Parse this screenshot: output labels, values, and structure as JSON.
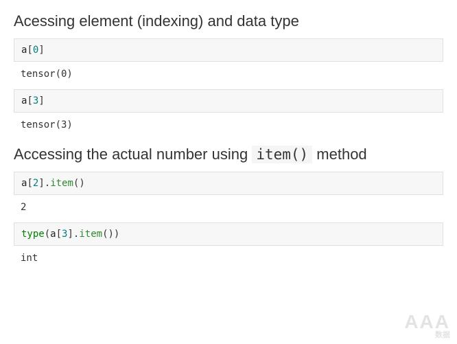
{
  "heading1": "Acessing element (indexing) and data type",
  "cell1": {
    "var": "a",
    "open": "[",
    "idx": "0",
    "close": "]"
  },
  "out1": "tensor(0)",
  "cell2": {
    "var": "a",
    "open": "[",
    "idx": "3",
    "close": "]"
  },
  "out2": "tensor(3)",
  "heading2_pre": "Accessing the actual number using ",
  "heading2_code": "item()",
  "heading2_post": " method",
  "cell3": {
    "var": "a",
    "open": "[",
    "idx": "2",
    "close": "]",
    "dot": ".",
    "method": "item",
    "parens": "()"
  },
  "out3": "2",
  "cell4": {
    "builtin": "type",
    "popen": "(",
    "var": "a",
    "open": "[",
    "idx": "3",
    "close": "]",
    "dot": ".",
    "method": "item",
    "mparens": "()",
    "pclose": ")"
  },
  "out4": "int",
  "watermark_main": "AAA",
  "watermark_sub": "数据"
}
